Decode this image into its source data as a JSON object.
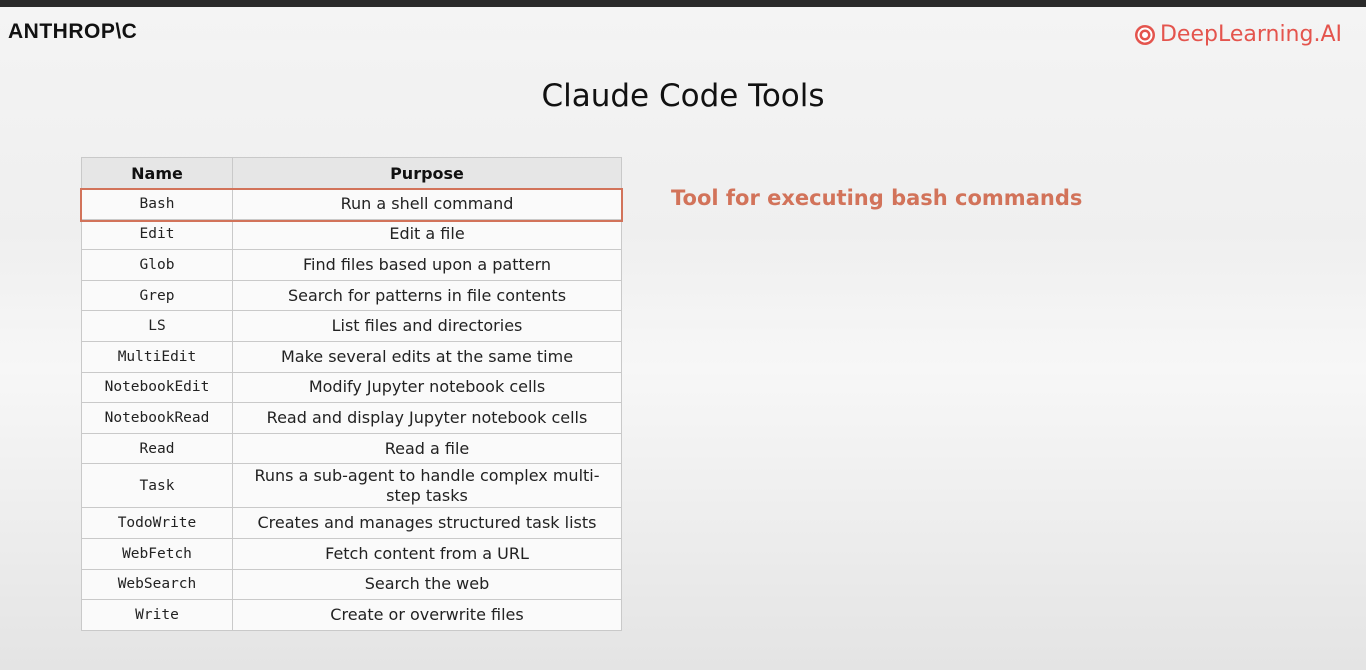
{
  "header": {
    "brand_left": "ANTHROP\\C",
    "brand_right": "DeepLearning.AI",
    "brand_right_icon": "deeplearning-logo-icon"
  },
  "slide": {
    "title": "Claude Code Tools",
    "callout": "Tool for executing bash commands",
    "highlighted_row": "Bash"
  },
  "colors": {
    "accent": "#d2735a",
    "brand_red": "#e4544d"
  },
  "table": {
    "headers": {
      "name": "Name",
      "purpose": "Purpose"
    },
    "rows": [
      {
        "name": "Bash",
        "purpose": "Run a shell command"
      },
      {
        "name": "Edit",
        "purpose": "Edit a file"
      },
      {
        "name": "Glob",
        "purpose": "Find files based upon a pattern"
      },
      {
        "name": "Grep",
        "purpose": "Search for patterns in file contents"
      },
      {
        "name": "LS",
        "purpose": "List files and directories"
      },
      {
        "name": "MultiEdit",
        "purpose": "Make several edits at the same time"
      },
      {
        "name": "NotebookEdit",
        "purpose": "Modify Jupyter notebook cells"
      },
      {
        "name": "NotebookRead",
        "purpose": "Read and display Jupyter notebook cells"
      },
      {
        "name": "Read",
        "purpose": "Read a file"
      },
      {
        "name": "Task",
        "purpose": "Runs a sub-agent to handle complex multi-step tasks"
      },
      {
        "name": "TodoWrite",
        "purpose": "Creates and manages structured task lists"
      },
      {
        "name": "WebFetch",
        "purpose": "Fetch content from a URL"
      },
      {
        "name": "WebSearch",
        "purpose": "Search the web"
      },
      {
        "name": "Write",
        "purpose": "Create or overwrite files"
      }
    ]
  }
}
